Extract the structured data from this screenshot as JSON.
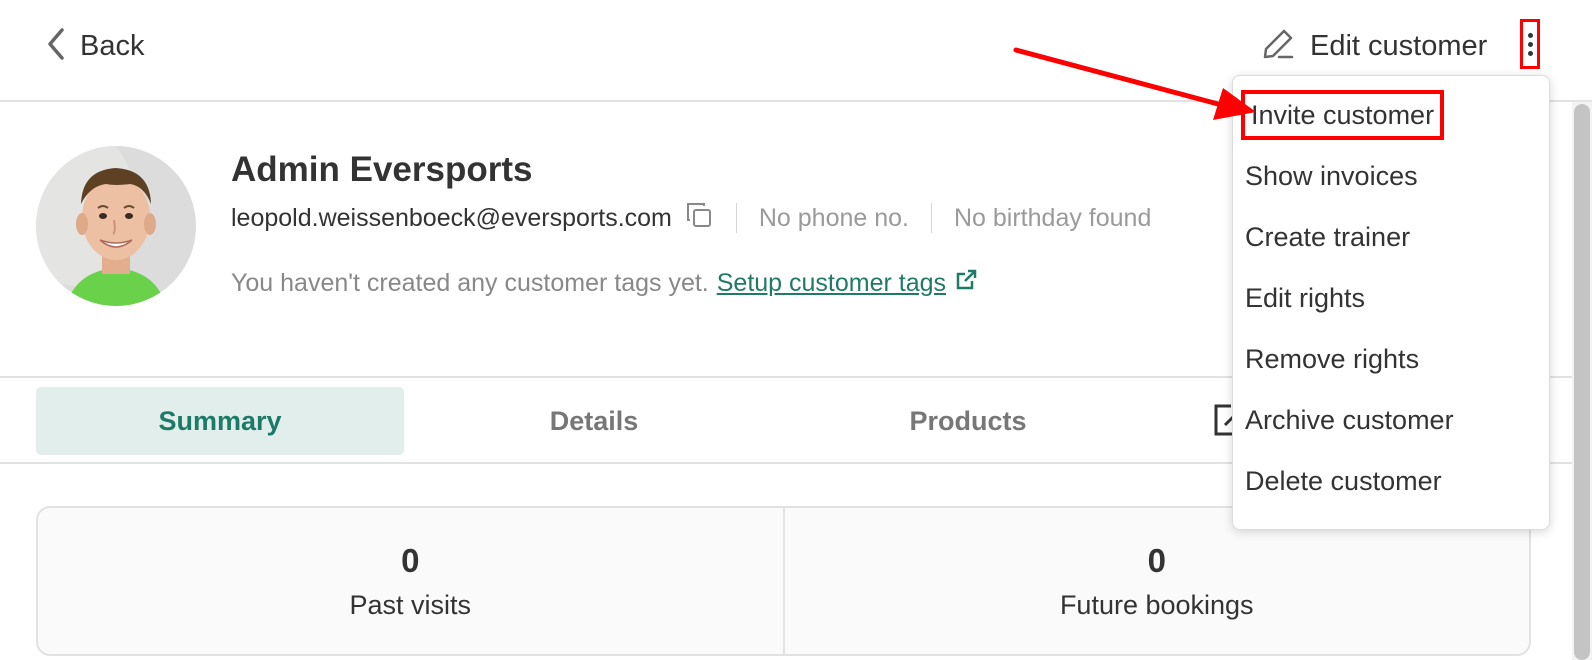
{
  "header": {
    "back_label": "Back",
    "edit_label": "Edit customer"
  },
  "customer": {
    "name": "Admin Eversports",
    "email": "leopold.weissenboeck@eversports.com",
    "phone": "No phone no.",
    "birthday": "No birthday found",
    "tags_text": "You haven't created any customer tags yet.",
    "tags_link": "Setup customer tags"
  },
  "tabs": [
    {
      "label": "Summary",
      "active": true
    },
    {
      "label": "Details",
      "active": false
    },
    {
      "label": "Products",
      "active": false
    }
  ],
  "stats": [
    {
      "value": "0",
      "label": "Past visits"
    },
    {
      "value": "0",
      "label": "Future bookings"
    }
  ],
  "menu": {
    "items": [
      {
        "label": "Invite customer"
      },
      {
        "label": "Show invoices"
      },
      {
        "label": "Create trainer"
      },
      {
        "label": "Edit rights"
      },
      {
        "label": "Remove rights"
      },
      {
        "label": "Archive customer"
      },
      {
        "label": "Delete customer"
      }
    ]
  },
  "colors": {
    "accent": "#1d7a68",
    "annotation": "#ff0000",
    "active_tab_bg": "#e2eeec"
  },
  "icons": [
    "chevron-left-icon",
    "pencil-icon",
    "kebab-menu-icon",
    "copy-icon",
    "external-link-icon",
    "edit-square-icon"
  ]
}
